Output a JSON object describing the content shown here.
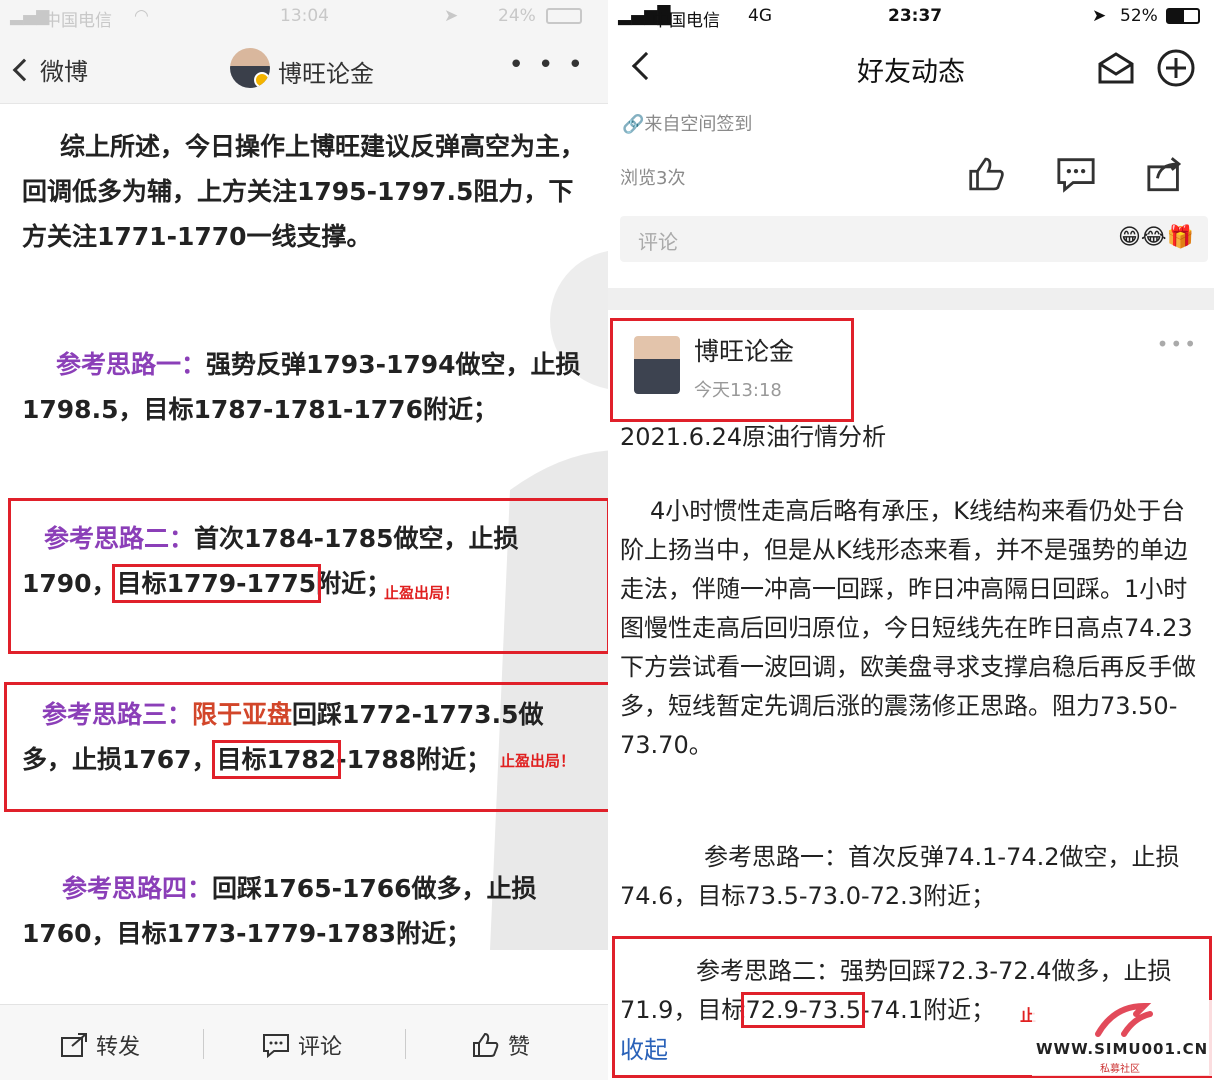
{
  "left": {
    "status": {
      "carrier": "中国电信",
      "time": "13:04",
      "battery": "24%"
    },
    "nav": {
      "back_label": "微博",
      "title": "博旺论金",
      "more": "• • •"
    },
    "summary": "综上所述，今日操作上博旺建议反弹高空为主，回调低多为辅，上方关注1795-1797.5阻力，下方关注1771-1770一线支撑。",
    "idea1": {
      "label": "参考思路一：",
      "text": "强势反弹1793-1794做空，止损1798.5，目标1787-1781-1776附近；"
    },
    "idea2": {
      "label": "参考思路二：",
      "text_a": "首次1784-1785做空，止损",
      "text_b": "1790，",
      "target": "目标1779-1775",
      "text_c": "附近；",
      "stamp": "止盈出局！"
    },
    "idea3": {
      "label": "参考思路三：",
      "highlight": "限于亚盘",
      "text_a": "回踩1772-1773.5做",
      "text_b": "多，止损1767，",
      "target": "目标1782",
      "text_c": "-1788附近；",
      "stamp": "止盈出局！"
    },
    "idea4": {
      "label": "参考思路四：",
      "text": "回踩1765-1766做多，止损1760，目标1773-1779-1783附近；"
    },
    "toolbar": {
      "repost": "转发",
      "comment": "评论",
      "like": "赞"
    }
  },
  "right": {
    "status": {
      "carrier": "中国电信",
      "network": "4G",
      "time": "23:37",
      "battery": "52%"
    },
    "nav": {
      "title": "好友动态"
    },
    "source": "来自空间签到",
    "views": "浏览3次",
    "comment_placeholder": "评论",
    "emoji": "😁😂🎁",
    "post": {
      "author": "博旺论金",
      "time": "今天13:18",
      "more": "•••",
      "headline": "2021.6.24原油行情分析",
      "body": "4小时惯性走高后略有承压，K线结构来看仍处于台阶上扬当中，但是从K线形态来看，并不是强势的单边走法，伴随一冲高一回踩，昨日冲高隔日回踩。1小时图慢性走高后回归原位，今日短线先在昨日高点74.23下方尝试看一波回调，欧美盘寻求支撑启稳后再反手做多，短线暂定先调后涨的震荡修正思路。阻力73.50-73.70。",
      "idea1": "参考思路一：首次反弹74.1-74.2做空，止损74.6，目标73.5-73.0-72.3附近；",
      "idea2_a": "参考思路二：强势回踩72.3-72.4做多，止损",
      "idea2_b": "71.9，目标",
      "idea2_target": "72.9-73.5",
      "idea2_c": "-74.1附近；",
      "idea2_stamp": "止",
      "collapse": "收起"
    },
    "logo": {
      "url": "WWW.SIMU001.CN",
      "sub": "私募社区"
    }
  }
}
